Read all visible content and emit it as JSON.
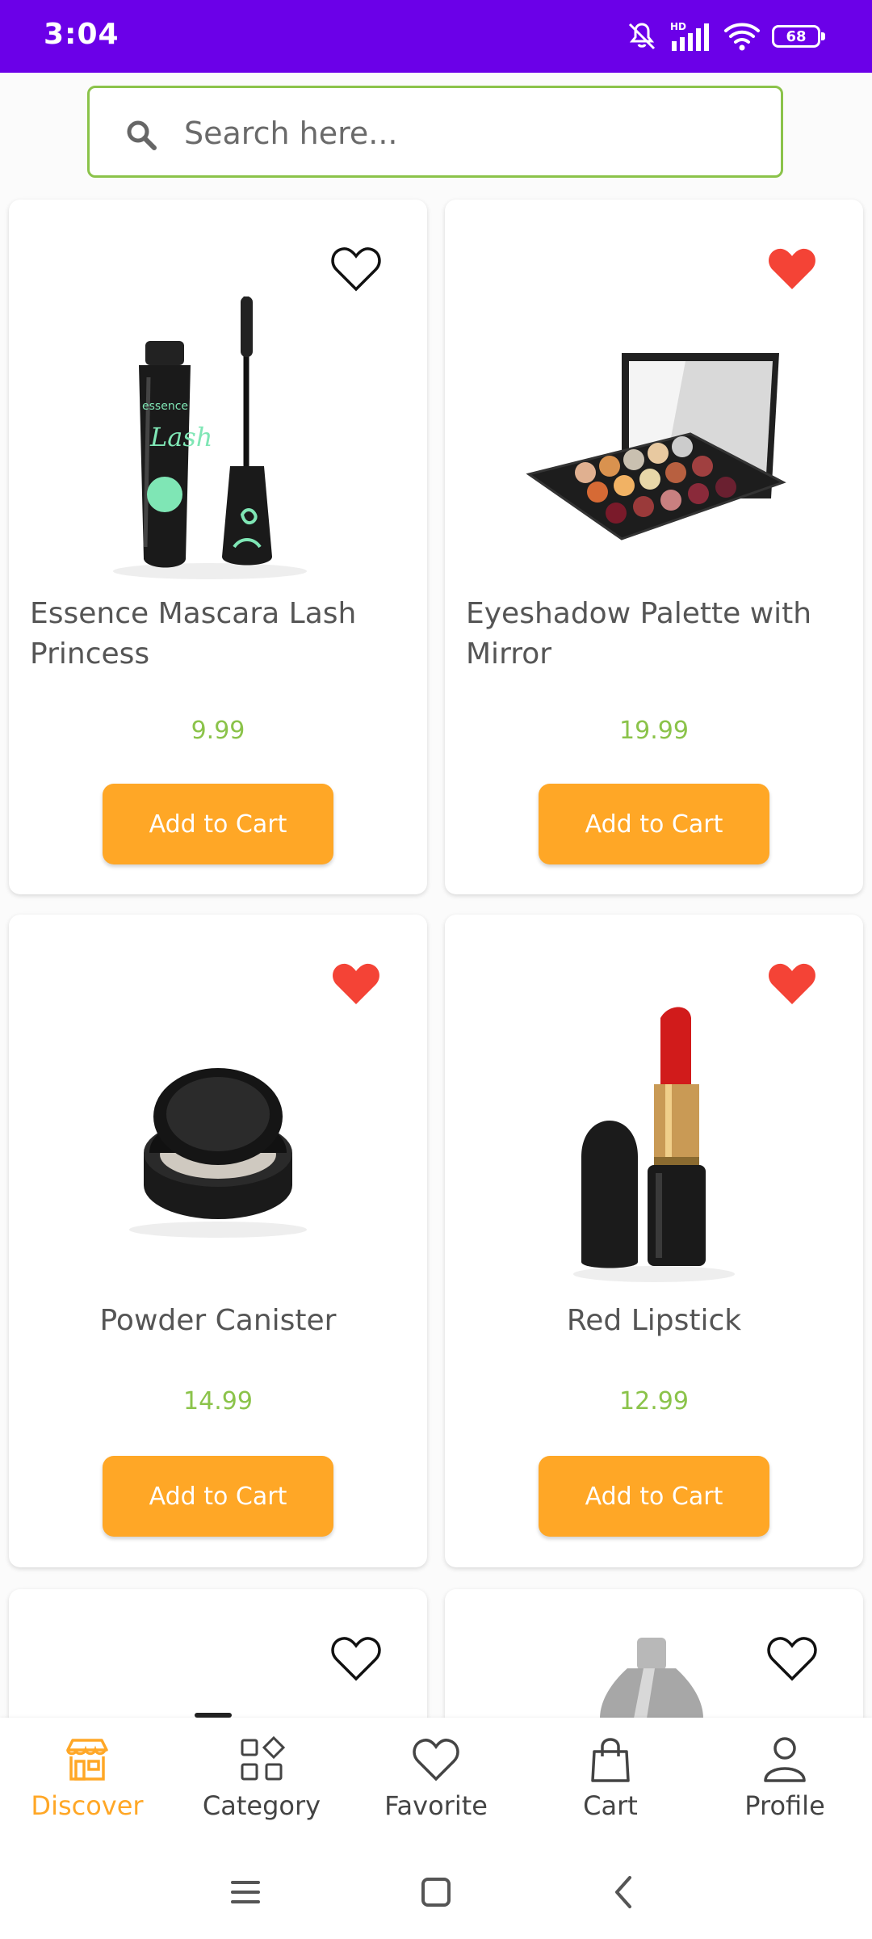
{
  "status_bar": {
    "time": "3:04",
    "battery": "68",
    "hd": "HD",
    "bg_color": "#6b00e8"
  },
  "search": {
    "placeholder": "Search here...",
    "value": ""
  },
  "products": [
    {
      "name": "Essence Mascara Lash Princess",
      "price": "9.99",
      "button": "Add to Cart",
      "favorite": false,
      "image": "mascara"
    },
    {
      "name": "Eyeshadow Palette with Mirror",
      "price": "19.99",
      "button": "Add to Cart",
      "favorite": true,
      "image": "eyeshadow-palette"
    },
    {
      "name": "Powder Canister",
      "price": "14.99",
      "button": "Add to Cart",
      "favorite": true,
      "image": "powder-compact"
    },
    {
      "name": "Red Lipstick",
      "price": "12.99",
      "button": "Add to Cart",
      "favorite": true,
      "image": "lipstick"
    },
    {
      "name": "",
      "price": "",
      "button": "",
      "favorite": false,
      "image": "partial-product"
    },
    {
      "name": "",
      "price": "",
      "button": "",
      "favorite": false,
      "image": "bottle"
    }
  ],
  "nav": [
    {
      "label": "Discover",
      "icon": "store-icon",
      "active": true
    },
    {
      "label": "Category",
      "icon": "category-icon",
      "active": false
    },
    {
      "label": "Favorite",
      "icon": "heart-icon",
      "active": false
    },
    {
      "label": "Cart",
      "icon": "bag-icon",
      "active": false
    },
    {
      "label": "Profile",
      "icon": "profile-icon",
      "active": false
    }
  ],
  "colors": {
    "accent": "#ffa726",
    "price": "#8bc34a",
    "favorite": "#f44336",
    "search_border": "#8bc34a"
  }
}
